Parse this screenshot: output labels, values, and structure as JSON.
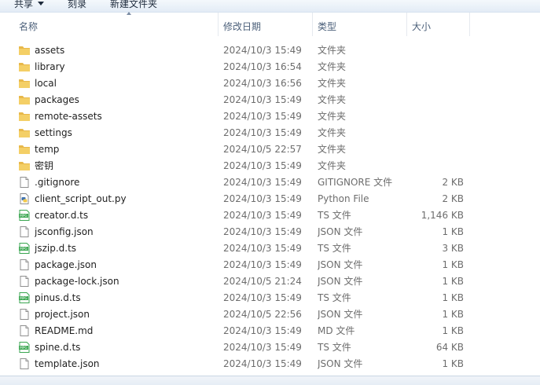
{
  "toolbar": {
    "share_label": "共享",
    "burn_label": "刻录",
    "new_folder_label": "新建文件夹"
  },
  "columns": {
    "name": "名称",
    "date": "修改日期",
    "type": "类型",
    "size": "大小"
  },
  "rows": [
    {
      "name": "assets",
      "date": "2024/10/3 15:49",
      "type": "文件夹",
      "size": "",
      "icon": "folder-icon"
    },
    {
      "name": "library",
      "date": "2024/10/3 16:54",
      "type": "文件夹",
      "size": "",
      "icon": "folder-icon"
    },
    {
      "name": "local",
      "date": "2024/10/3 16:56",
      "type": "文件夹",
      "size": "",
      "icon": "folder-icon"
    },
    {
      "name": "packages",
      "date": "2024/10/3 15:49",
      "type": "文件夹",
      "size": "",
      "icon": "folder-icon"
    },
    {
      "name": "remote-assets",
      "date": "2024/10/3 15:49",
      "type": "文件夹",
      "size": "",
      "icon": "folder-icon"
    },
    {
      "name": "settings",
      "date": "2024/10/3 15:49",
      "type": "文件夹",
      "size": "",
      "icon": "folder-icon"
    },
    {
      "name": "temp",
      "date": "2024/10/5 22:57",
      "type": "文件夹",
      "size": "",
      "icon": "folder-icon"
    },
    {
      "name": "密钥",
      "date": "2024/10/3 15:49",
      "type": "文件夹",
      "size": "",
      "icon": "folder-icon"
    },
    {
      "name": ".gitignore",
      "date": "2024/10/3 15:49",
      "type": "GITIGNORE 文件",
      "size": "2 KB",
      "icon": "file-icon"
    },
    {
      "name": "client_script_out.py",
      "date": "2024/10/3 15:49",
      "type": "Python File",
      "size": "2 KB",
      "icon": "python-file-icon"
    },
    {
      "name": "creator.d.ts",
      "date": "2024/10/3 15:49",
      "type": "TS 文件",
      "size": "1,146 KB",
      "icon": "ts-file-icon"
    },
    {
      "name": "jsconfig.json",
      "date": "2024/10/3 15:49",
      "type": "JSON 文件",
      "size": "1 KB",
      "icon": "file-icon"
    },
    {
      "name": "jszip.d.ts",
      "date": "2024/10/3 15:49",
      "type": "TS 文件",
      "size": "3 KB",
      "icon": "ts-file-icon"
    },
    {
      "name": "package.json",
      "date": "2024/10/3 15:49",
      "type": "JSON 文件",
      "size": "1 KB",
      "icon": "file-icon"
    },
    {
      "name": "package-lock.json",
      "date": "2024/10/5 21:24",
      "type": "JSON 文件",
      "size": "1 KB",
      "icon": "file-icon"
    },
    {
      "name": "pinus.d.ts",
      "date": "2024/10/3 15:49",
      "type": "TS 文件",
      "size": "1 KB",
      "icon": "ts-file-icon"
    },
    {
      "name": "project.json",
      "date": "2024/10/5 22:56",
      "type": "JSON 文件",
      "size": "1 KB",
      "icon": "file-icon"
    },
    {
      "name": "README.md",
      "date": "2024/10/3 15:49",
      "type": "MD 文件",
      "size": "1 KB",
      "icon": "file-icon"
    },
    {
      "name": "spine.d.ts",
      "date": "2024/10/3 15:49",
      "type": "TS 文件",
      "size": "64 KB",
      "icon": "ts-file-icon"
    },
    {
      "name": "template.json",
      "date": "2024/10/3 15:49",
      "type": "JSON 文件",
      "size": "1 KB",
      "icon": "file-icon"
    }
  ],
  "colors": {
    "folder": "#e8b84a",
    "ts_green": "#3aa650",
    "python_blue": "#3a6fb0",
    "python_yellow": "#f2c94c"
  }
}
